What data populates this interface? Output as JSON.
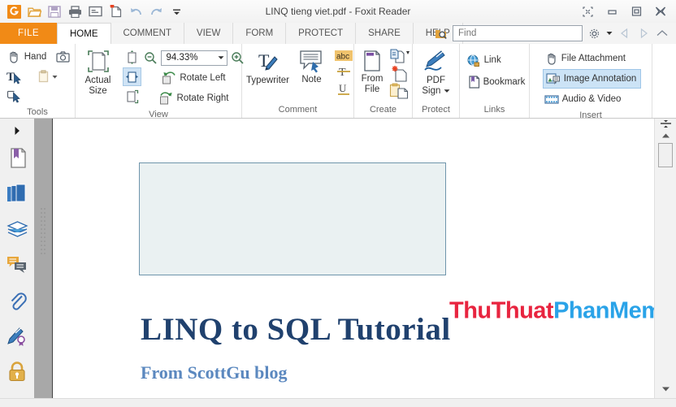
{
  "window": {
    "title": "LINQ tieng viet.pdf - Foxit Reader",
    "controls": [
      {
        "name": "restore-tabs-icon",
        "glyph": "⛶"
      },
      {
        "name": "minimize-icon",
        "glyph": "▭"
      },
      {
        "name": "maximize-icon",
        "glyph": "❐"
      },
      {
        "name": "close-icon",
        "glyph": "✖"
      }
    ]
  },
  "quick_access": [
    {
      "name": "foxit-logo-icon",
      "tip": "Foxit"
    },
    {
      "name": "open-file-icon",
      "tip": "Open"
    },
    {
      "name": "save-icon",
      "tip": "Save"
    },
    {
      "name": "print-icon",
      "tip": "Print"
    },
    {
      "name": "email-icon",
      "tip": "Email"
    },
    {
      "name": "new-from-file-icon",
      "tip": "Create PDF"
    },
    {
      "name": "undo-icon",
      "tip": "Undo"
    },
    {
      "name": "redo-icon",
      "tip": "Redo"
    },
    {
      "name": "qat-dropdown-icon",
      "tip": "Customize"
    }
  ],
  "tabs": {
    "file_label": "FILE",
    "items": [
      {
        "label": "HOME",
        "active": true
      },
      {
        "label": "COMMENT",
        "active": false
      },
      {
        "label": "VIEW",
        "active": false
      },
      {
        "label": "FORM",
        "active": false
      },
      {
        "label": "PROTECT",
        "active": false
      },
      {
        "label": "SHARE",
        "active": false
      },
      {
        "label": "HELP",
        "active": false
      }
    ]
  },
  "search": {
    "placeholder": "Find",
    "value": "",
    "advanced_search_icon": "advanced-search-icon",
    "settings_icon": "settings-gear-icon",
    "prev_icon": "previous-page-icon",
    "next_icon": "next-page-icon",
    "collapse_icon": "collapse-ribbon-icon"
  },
  "ribbon": {
    "groups": [
      {
        "label": "Tools",
        "items": [
          {
            "name": "hand-tool",
            "label": "Hand"
          },
          {
            "name": "snapshot-tool",
            "label": ""
          },
          {
            "name": "select-text-tool",
            "label": ""
          },
          {
            "name": "clipboard-paste-tool",
            "label": ""
          },
          {
            "name": "select-annotation-tool",
            "label": ""
          }
        ]
      },
      {
        "label": "View",
        "items": [
          {
            "name": "actual-size-button",
            "label": "Actual Size"
          },
          {
            "name": "fit-page-button",
            "label": ""
          },
          {
            "name": "fit-width-button",
            "label": ""
          },
          {
            "name": "fit-visible-button",
            "label": ""
          },
          {
            "name": "zoom-out-button",
            "label": ""
          },
          {
            "name": "zoom-in-button",
            "label": ""
          },
          {
            "name": "rotate-left-button",
            "label": "Rotate Left"
          },
          {
            "name": "rotate-right-button",
            "label": "Rotate Right"
          }
        ],
        "zoom_value": "94.33%"
      },
      {
        "label": "Comment",
        "items": [
          {
            "name": "typewriter-button",
            "label": "Typewriter"
          },
          {
            "name": "note-button",
            "label": "Note"
          },
          {
            "name": "highlight-button",
            "label": "abc"
          },
          {
            "name": "strikeout-button",
            "label": "T"
          },
          {
            "name": "underline-button",
            "label": "U"
          }
        ]
      },
      {
        "label": "Create",
        "items": [
          {
            "name": "from-file-button",
            "label": "From File"
          },
          {
            "name": "from-scanner-button",
            "label": ""
          },
          {
            "name": "blank-page-button",
            "label": ""
          },
          {
            "name": "from-clipboard-button",
            "label": ""
          }
        ]
      },
      {
        "label": "Protect",
        "items": [
          {
            "name": "pdf-sign-button",
            "label": "PDF Sign"
          }
        ]
      },
      {
        "label": "Links",
        "items": [
          {
            "name": "link-button",
            "label": "Link"
          },
          {
            "name": "bookmark-button",
            "label": "Bookmark"
          }
        ]
      },
      {
        "label": "Insert",
        "items": [
          {
            "name": "file-attachment-button",
            "label": "File Attachment"
          },
          {
            "name": "image-annotation-button",
            "label": "Image Annotation",
            "selected": true
          },
          {
            "name": "audio-video-button",
            "label": "Audio & Video"
          }
        ]
      }
    ]
  },
  "sidebar": {
    "toggle_icon": "expand-panel-arrow-icon",
    "items": [
      {
        "name": "bookmarks-panel-icon",
        "label": "Bookmarks"
      },
      {
        "name": "pages-panel-icon",
        "label": "Page Thumbnails"
      },
      {
        "name": "layers-panel-icon",
        "label": "Layers"
      },
      {
        "name": "comments-panel-icon",
        "label": "Comments"
      },
      {
        "name": "attachments-panel-icon",
        "label": "Attachments"
      },
      {
        "name": "signatures-panel-icon",
        "label": "Digital Signatures"
      },
      {
        "name": "security-panel-icon",
        "label": "Security"
      }
    ]
  },
  "document": {
    "title": "LINQ to SQL Tutorial",
    "subtitle": "From ScottGu blog",
    "watermark": {
      "part1": "ThuThuat",
      "part2": "PhanMem.vn"
    },
    "placeholder_box": {
      "name": "image-placeholder-box"
    }
  },
  "colors": {
    "file_tab": "#f18a16",
    "doc_title": "#20416e",
    "doc_subtitle": "#5b88bf",
    "watermark_red": "#e8243f",
    "watermark_blue": "#2aa3e8",
    "box_fill": "#eaf1f2",
    "box_border": "#6f95ab",
    "selection": "#cce3f6"
  },
  "scrollbar": {
    "split_icon": "split-view-handle-icon",
    "up_icon": "scroll-up-arrow-icon",
    "down_icon": "scroll-down-arrow-icon",
    "thumb": "scroll-thumb"
  }
}
